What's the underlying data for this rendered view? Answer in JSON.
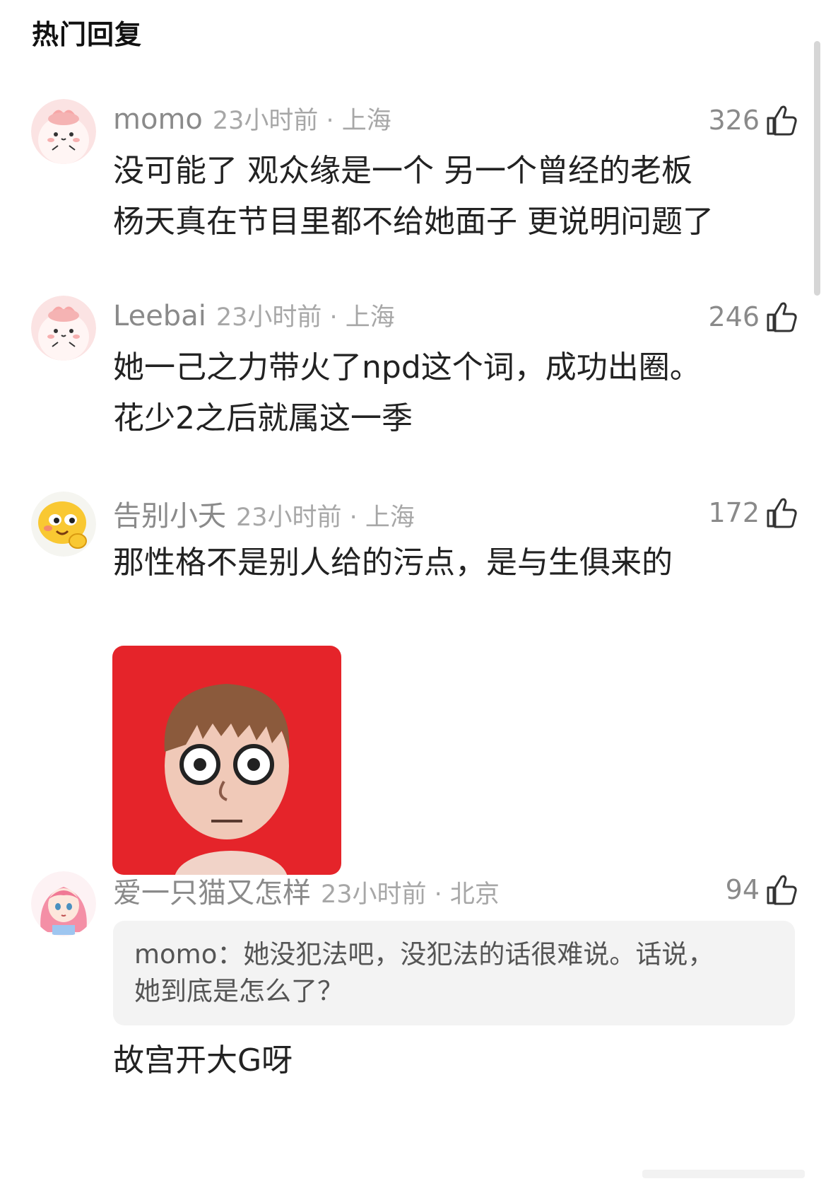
{
  "header": {
    "title": "热门回复"
  },
  "comments": [
    {
      "username": "momo",
      "time": "23小时前 · 上海",
      "likes": "326",
      "avatar": "pink-bunny-avatar",
      "lines": [
        "没可能了  观众缘是一个  另一个曾经的老板",
        "杨天真在节目里都不给她面子 更说明问题了"
      ]
    },
    {
      "username": "Leebai",
      "time": "23小时前 · 上海",
      "likes": "246",
      "avatar": "pink-bunny-avatar",
      "lines": [
        "她一己之力带火了npd这个词，成功出圈。",
        "花少2之后就属这一季"
      ]
    },
    {
      "username": "告别小夭",
      "time": "23小时前 · 上海",
      "likes": "172",
      "avatar": "yellow-blob-emoji-avatar",
      "lines": [
        "那性格不是别人给的污点，是与生俱来的"
      ],
      "sticker": "mii-staring-face-sticker"
    },
    {
      "username": "爱一只猫又怎样",
      "time": "23小时前 · 北京",
      "likes": "94",
      "avatar": "pink-hair-anime-girl-avatar",
      "quote": {
        "author": "momo",
        "lines": [
          "momo：她没犯法吧，没犯法的话很难说。话说，",
          "她到底是怎么了？"
        ]
      },
      "lines": [
        "故宫开大G呀"
      ]
    }
  ],
  "colors": {
    "meta_gray": "#8a8a8a",
    "text": "#222222",
    "quote_bg": "#f3f3f3",
    "sticker_bg": "#e5242a"
  }
}
